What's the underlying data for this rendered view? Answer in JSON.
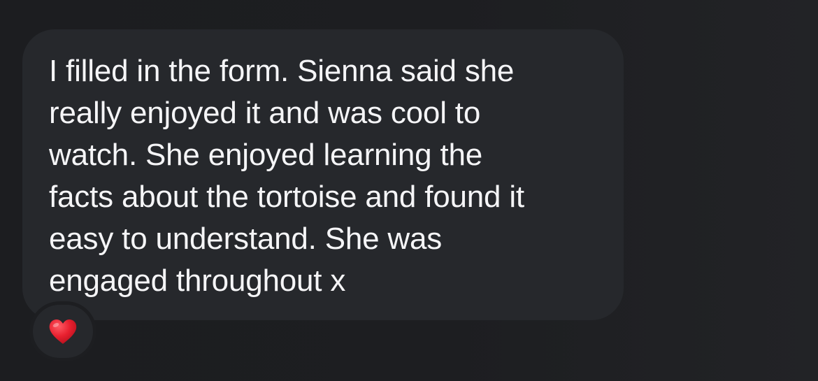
{
  "message": {
    "text": "I filled in the form. Sienna said she\nreally enjoyed it and was cool to\nwatch. She enjoyed learning the\nfacts about the tortoise and found it\neasy to understand. She was\nengaged throughout x"
  },
  "reaction": {
    "icon": "heart-icon",
    "color": "#e8202f"
  },
  "colors": {
    "background": "#1d1e21",
    "bubble": "#26282c",
    "text": "#f5f5f7"
  }
}
